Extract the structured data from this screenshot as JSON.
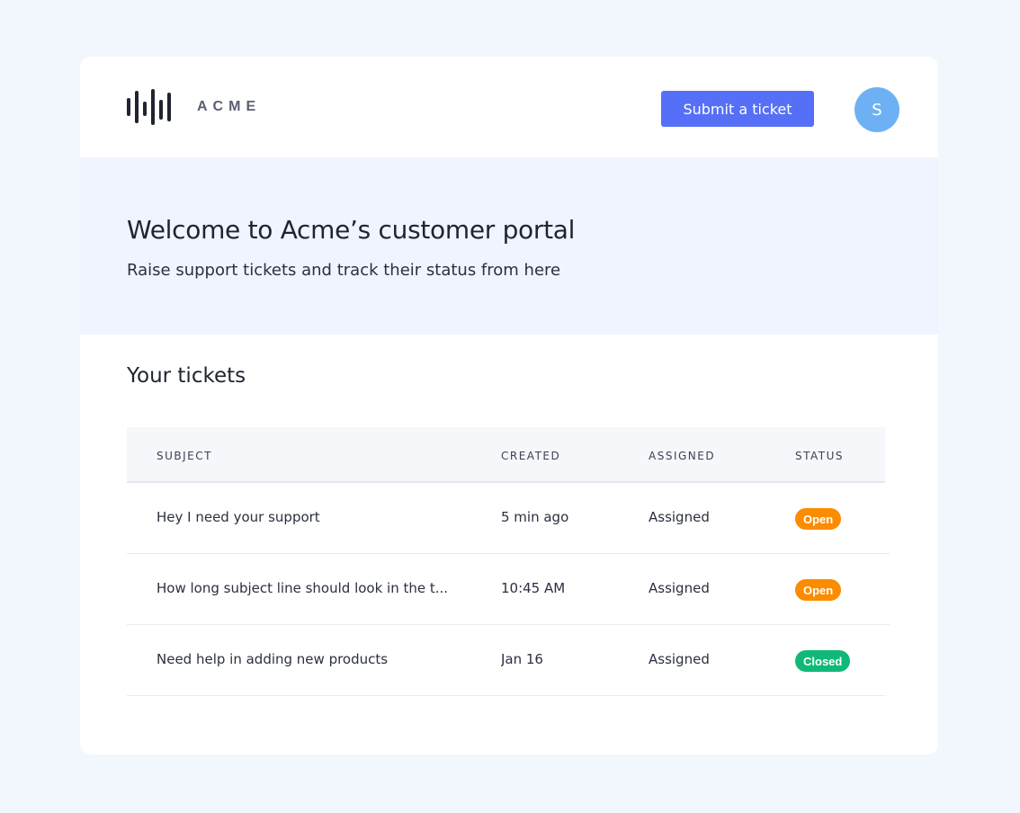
{
  "brand": {
    "name": "ACME",
    "accent": "#5570f6"
  },
  "header": {
    "submit_label": "Submit a ticket",
    "avatar_initial": "S"
  },
  "hero": {
    "title": "Welcome to Acme’s customer portal",
    "subtitle": "Raise support tickets and track their status from here"
  },
  "tickets": {
    "title": "Your tickets",
    "columns": {
      "subject": "SUBJECT",
      "created": "CREATED",
      "assigned": "ASSIGNED",
      "status": "STATUS"
    },
    "rows": [
      {
        "subject": "Hey I need your support",
        "created": "5 min ago",
        "assigned": "Assigned",
        "status": "Open",
        "status_color": "#fb8c00"
      },
      {
        "subject": "How long subject line should look in the t...",
        "created": "10:45 AM",
        "assigned": "Assigned",
        "status": "Open",
        "status_color": "#fb8c00"
      },
      {
        "subject": "Need help in adding new products",
        "created": "Jan 16",
        "assigned": "Assigned",
        "status": "Closed",
        "status_color": "#11b978"
      }
    ]
  }
}
